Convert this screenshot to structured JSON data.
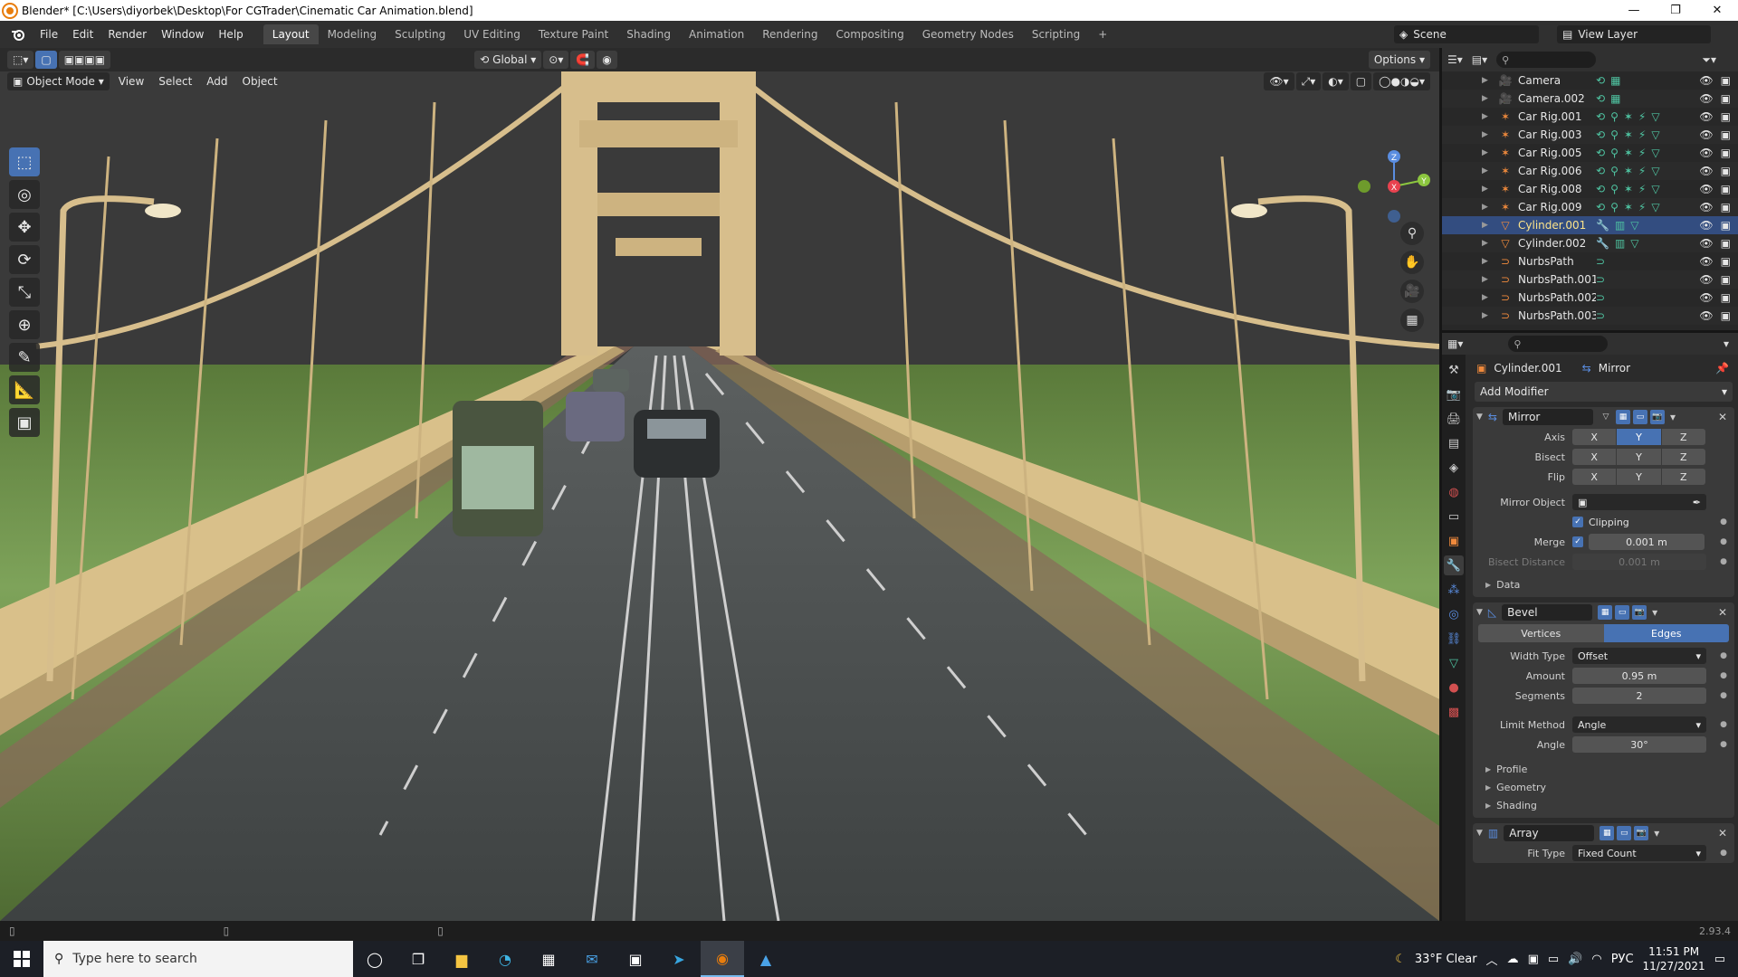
{
  "window": {
    "title": "Blender* [C:\\Users\\diyorbek\\Desktop\\For CGTrader\\Cinematic Car Animation.blend]",
    "minimize": "—",
    "maximize": "❐",
    "close": "✕"
  },
  "topbar": {
    "menus": [
      "File",
      "Edit",
      "Render",
      "Window",
      "Help"
    ],
    "workspaces": [
      "Layout",
      "Modeling",
      "Sculpting",
      "UV Editing",
      "Texture Paint",
      "Shading",
      "Animation",
      "Rendering",
      "Compositing",
      "Geometry Nodes",
      "Scripting"
    ],
    "active_workspace": "Layout",
    "add_tab": "+",
    "scene": "Scene",
    "view_layer": "View Layer"
  },
  "viewport": {
    "orientation": "Global",
    "options": "Options",
    "mode": "Object Mode",
    "menus": [
      "View",
      "Select",
      "Add",
      "Object"
    ]
  },
  "outliner": {
    "rows": [
      {
        "name": "Camera",
        "type": "camera",
        "color": "#f08a3c"
      },
      {
        "name": "Camera.002",
        "type": "camera",
        "color": "#f08a3c"
      },
      {
        "name": "Car Rig.001",
        "type": "armature",
        "color": "#f08a3c"
      },
      {
        "name": "Car Rig.003",
        "type": "armature",
        "color": "#f08a3c"
      },
      {
        "name": "Car Rig.005",
        "type": "armature",
        "color": "#f08a3c"
      },
      {
        "name": "Car Rig.006",
        "type": "armature",
        "color": "#f08a3c"
      },
      {
        "name": "Car Rig.008",
        "type": "armature",
        "color": "#f08a3c"
      },
      {
        "name": "Car Rig.009",
        "type": "armature",
        "color": "#f08a3c"
      },
      {
        "name": "Cylinder.001",
        "type": "mesh",
        "color": "#f08a3c",
        "selected": true
      },
      {
        "name": "Cylinder.002",
        "type": "mesh",
        "color": "#f08a3c"
      },
      {
        "name": "NurbsPath",
        "type": "curve",
        "color": "#f08a3c"
      },
      {
        "name": "NurbsPath.001",
        "type": "curve",
        "color": "#f08a3c"
      },
      {
        "name": "NurbsPath.002",
        "type": "curve",
        "color": "#f08a3c"
      },
      {
        "name": "NurbsPath.003",
        "type": "curve",
        "color": "#f08a3c"
      }
    ]
  },
  "properties": {
    "object_name": "Cylinder.001",
    "modifier_crumb": "Mirror",
    "add_modifier": "Add Modifier",
    "mirror": {
      "name": "Mirror",
      "axis_label": "Axis",
      "bisect_label": "Bisect",
      "flip_label": "Flip",
      "xyz": [
        "X",
        "Y",
        "Z"
      ],
      "mirror_object_label": "Mirror Object",
      "clipping_label": "Clipping",
      "merge_label": "Merge",
      "merge_value": "0.001 m",
      "bisect_distance_label": "Bisect Distance",
      "bisect_distance_value": "0.001 m",
      "data_label": "Data"
    },
    "bevel": {
      "name": "Bevel",
      "tabs": [
        "Vertices",
        "Edges"
      ],
      "width_type_label": "Width Type",
      "width_type_value": "Offset",
      "amount_label": "Amount",
      "amount_value": "0.95 m",
      "segments_label": "Segments",
      "segments_value": "2",
      "limit_method_label": "Limit Method",
      "limit_method_value": "Angle",
      "angle_label": "Angle",
      "angle_value": "30°",
      "subpanels": [
        "Profile",
        "Geometry",
        "Shading"
      ]
    },
    "array": {
      "name": "Array",
      "fit_type_label": "Fit Type",
      "fit_type_value": "Fixed Count"
    }
  },
  "status": {
    "version": "2.93.4"
  },
  "taskbar": {
    "search_placeholder": "Type here to search",
    "weather": "33°F  Clear",
    "language": "РУС",
    "time": "11:51 PM",
    "date": "11/27/2021"
  },
  "colors": {
    "accent": "#4772b3",
    "selected_row": "#334d80",
    "active_name": "#fbe38a"
  }
}
